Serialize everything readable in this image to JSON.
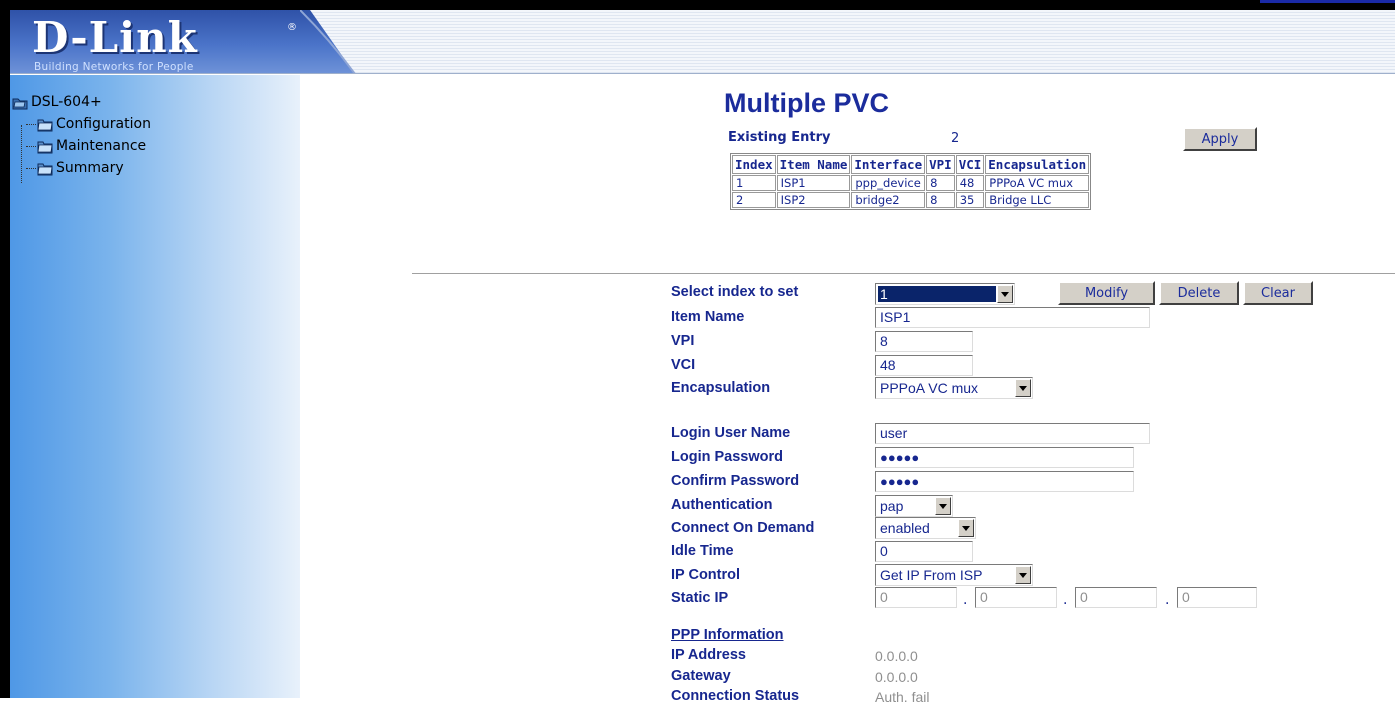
{
  "header": {
    "logo": "D-Link",
    "registered_mark": "®",
    "tagline": "Building Networks for People"
  },
  "sidebar": {
    "root": "DSL-604+",
    "items": [
      {
        "label": "Configuration"
      },
      {
        "label": "Maintenance"
      },
      {
        "label": "Summary"
      }
    ]
  },
  "main": {
    "title": "Multiple PVC",
    "existing_entry_label": "Existing Entry",
    "existing_entry_count": "2",
    "apply_label": "Apply",
    "table": {
      "headers": [
        "Index",
        "Item Name",
        "Interface",
        "VPI",
        "VCI",
        "Encapsulation"
      ],
      "rows": [
        [
          "1",
          "ISP1",
          "ppp_device",
          "8",
          "48",
          "PPPoA VC mux"
        ],
        [
          "2",
          "ISP2",
          "bridge2",
          "8",
          "35",
          "Bridge LLC"
        ]
      ]
    }
  },
  "form": {
    "select_index_label": "Select index to set",
    "select_index_value": "1",
    "modify_label": "Modify",
    "delete_label": "Delete",
    "clear_label": "Clear",
    "item_name_label": "Item Name",
    "item_name_value": "ISP1",
    "vpi_label": "VPI",
    "vpi_value": "8",
    "vci_label": "VCI",
    "vci_value": "48",
    "encapsulation_label": "Encapsulation",
    "encapsulation_value": "PPPoA VC mux",
    "login_user_label": "Login User Name",
    "login_user_value": "user",
    "login_password_label": "Login Password",
    "login_password_value": "●●●●●",
    "confirm_password_label": "Confirm Password",
    "confirm_password_value": "●●●●●",
    "authentication_label": "Authentication",
    "authentication_value": "pap",
    "connect_on_demand_label": "Connect On Demand",
    "connect_on_demand_value": "enabled",
    "idle_time_label": "Idle Time",
    "idle_time_value": "0",
    "ip_control_label": "IP Control",
    "ip_control_value": "Get IP From ISP",
    "static_ip_label": "Static IP",
    "static_ip_octets": [
      "0",
      "0",
      "0",
      "0"
    ],
    "ip_separator": "."
  },
  "ppp_info": {
    "heading": "PPP Information",
    "ip_address_label": "IP Address",
    "ip_address_value": "0.0.0.0",
    "gateway_label": "Gateway",
    "gateway_value": "0.0.0.0",
    "connection_status_label": "Connection Status",
    "connection_status_value": "Auth. fail"
  },
  "colors": {
    "label_blue": "#17278f",
    "title_blue": "#1b2c9c",
    "sidebar_gradient_start": "#4f98e6",
    "selection_highlight": "#0a246a"
  }
}
